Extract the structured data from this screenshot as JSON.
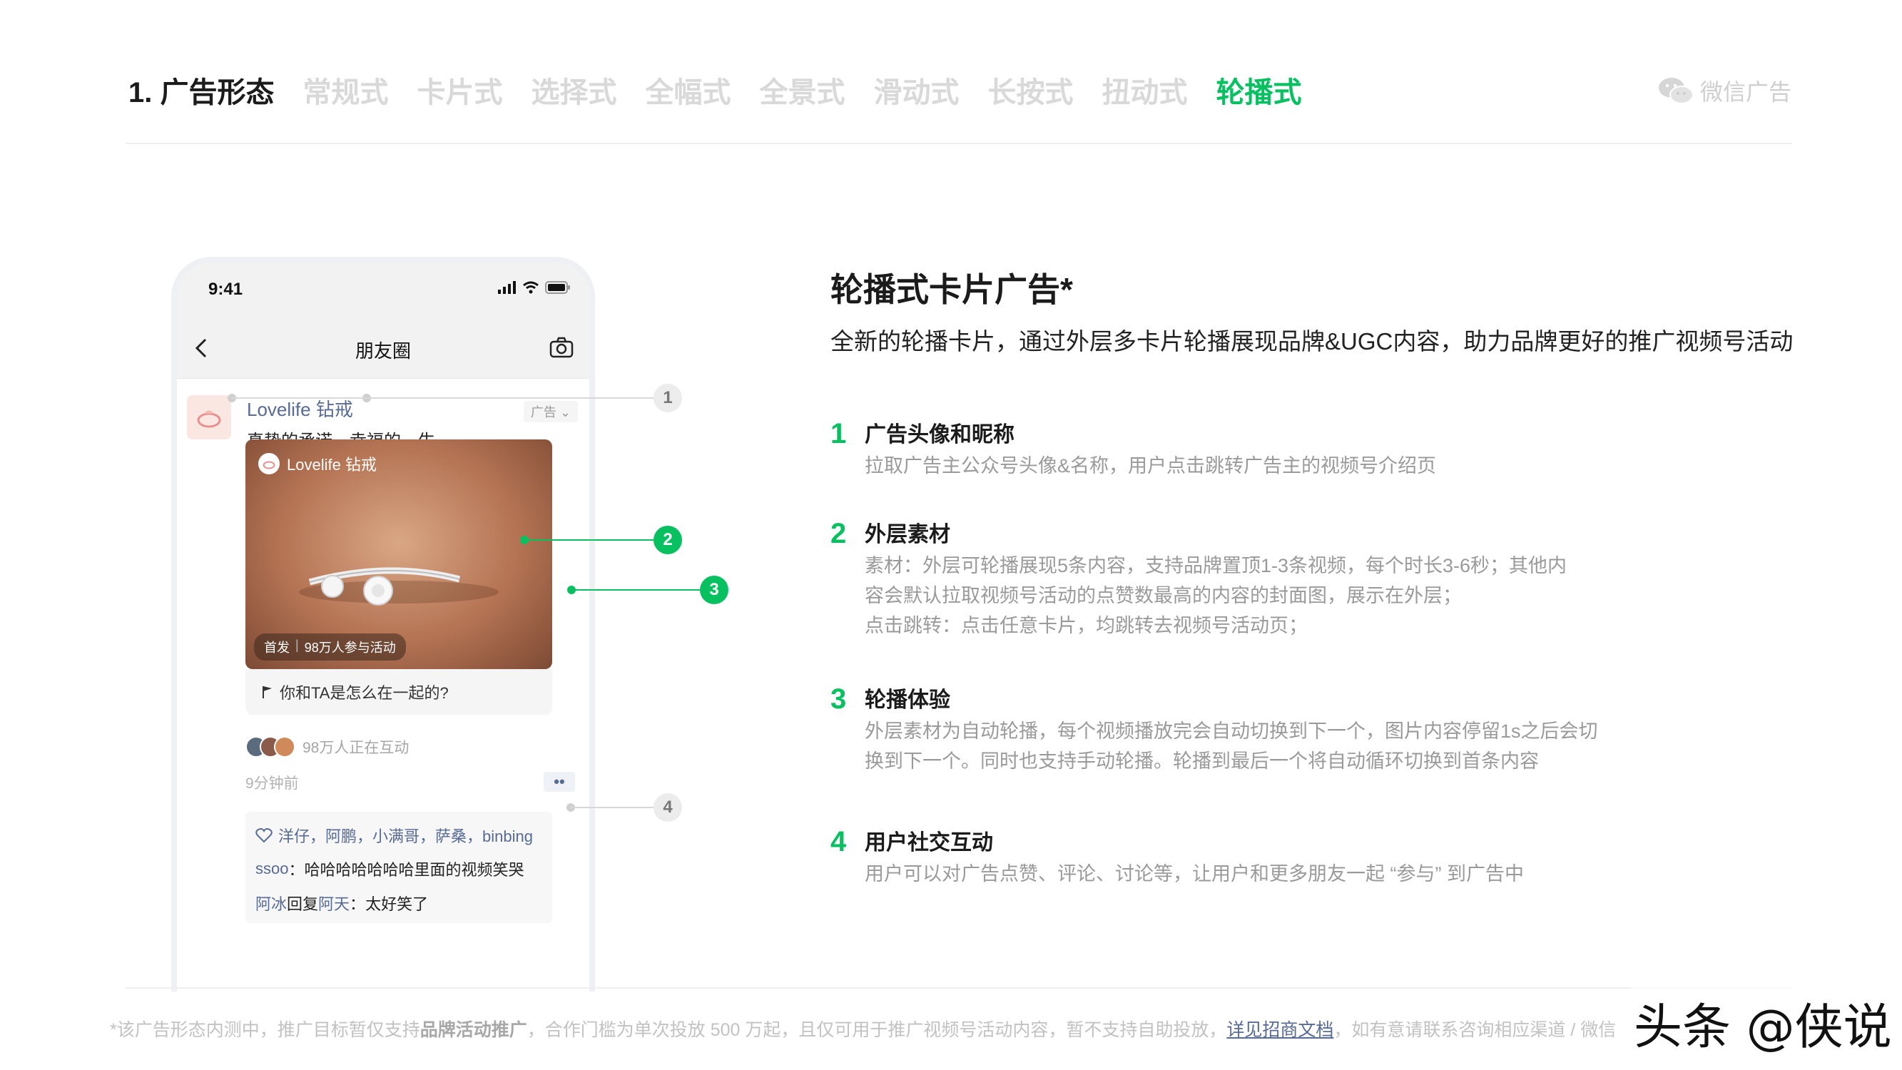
{
  "header": {
    "title": "1. 广告形态",
    "tabs": [
      {
        "label": "常规式",
        "active": false
      },
      {
        "label": "卡片式",
        "active": false
      },
      {
        "label": "选择式",
        "active": false
      },
      {
        "label": "全幅式",
        "active": false
      },
      {
        "label": "全景式",
        "active": false
      },
      {
        "label": "滑动式",
        "active": false
      },
      {
        "label": "长按式",
        "active": false
      },
      {
        "label": "扭动式",
        "active": false
      },
      {
        "label": "轮播式",
        "active": true
      }
    ],
    "brand": {
      "label": "微信广告",
      "icon": "wechat-icon"
    }
  },
  "colors": {
    "accent": "#07c160",
    "link": "#576b95",
    "muted": "#9a9a9a",
    "tab_inactive": "#d9d9d9"
  },
  "phone": {
    "time": "9:41",
    "nav_title": "朋友圈",
    "post": {
      "nickname": "Lovelife 钻戒",
      "ad_tag": "广告",
      "text": "真挚的承诺，幸福的一生",
      "card": {
        "brand": "Lovelife 钻戒",
        "badge_left": "首发",
        "badge_right": "98万人参与活动",
        "question": "你和TA是怎么在一起的?"
      },
      "interacting": "98万人正在互动",
      "time_ago": "9分钟前",
      "more": "••",
      "likes": "洋仔，阿鹏，小满哥，萨桑，binbing",
      "comments": [
        {
          "user": "ssoo",
          "sep": "：",
          "text": "哈哈哈哈哈哈哈里面的视频笑哭"
        },
        {
          "user": "阿冰",
          "reply_word": " 回复 ",
          "to": "阿天",
          "sep": "：",
          "text": "太好笑了"
        }
      ]
    },
    "callouts": [
      "1",
      "2",
      "3",
      "4"
    ]
  },
  "content": {
    "title": "轮播式卡片广告*",
    "subtitle": "全新的轮播卡片，通过外层多卡片轮播展现品牌&UGC内容，助力品牌更好的推广视频号活动",
    "features": [
      {
        "num": "1",
        "title": "广告头像和昵称",
        "lines": [
          "拉取广告主公众号头像&名称，用户点击跳转广告主的视频号介绍页"
        ]
      },
      {
        "num": "2",
        "title": "外层素材",
        "lines": [
          "素材：外层可轮播展现5条内容，支持品牌置顶1-3条视频，每个时长3-6秒；其他内",
          "容会默认拉取视频号活动的点赞数最高的内容的封面图，展示在外层；",
          "点击跳转：点击任意卡片，均跳转去视频号活动页；"
        ]
      },
      {
        "num": "3",
        "title": "轮播体验",
        "lines": [
          "外层素材为自动轮播，每个视频播放完会自动切换到下一个，图片内容停留1s之后会切",
          "换到下一个。同时也支持手动轮播。轮播到最后一个将自动循环切换到首条内容"
        ]
      },
      {
        "num": "4",
        "title": "用户社交互动",
        "lines": [
          "用户可以对广告点赞、评论、讨论等，让用户和更多朋友一起 “参与” 到广告中"
        ]
      }
    ]
  },
  "footer": {
    "part1": "*该广告形态内测中，推广目标暂仅支持",
    "bold": "品牌活动推广",
    "part2": "，合作门槛为单次投放 500 万起，且仅可用于推广视频号活动内容，暂不支持自助投放，",
    "link": "详见招商文档",
    "part3": "，如有意请联系咨询相应渠道 / 微信"
  },
  "watermark": "头条 @侠说"
}
